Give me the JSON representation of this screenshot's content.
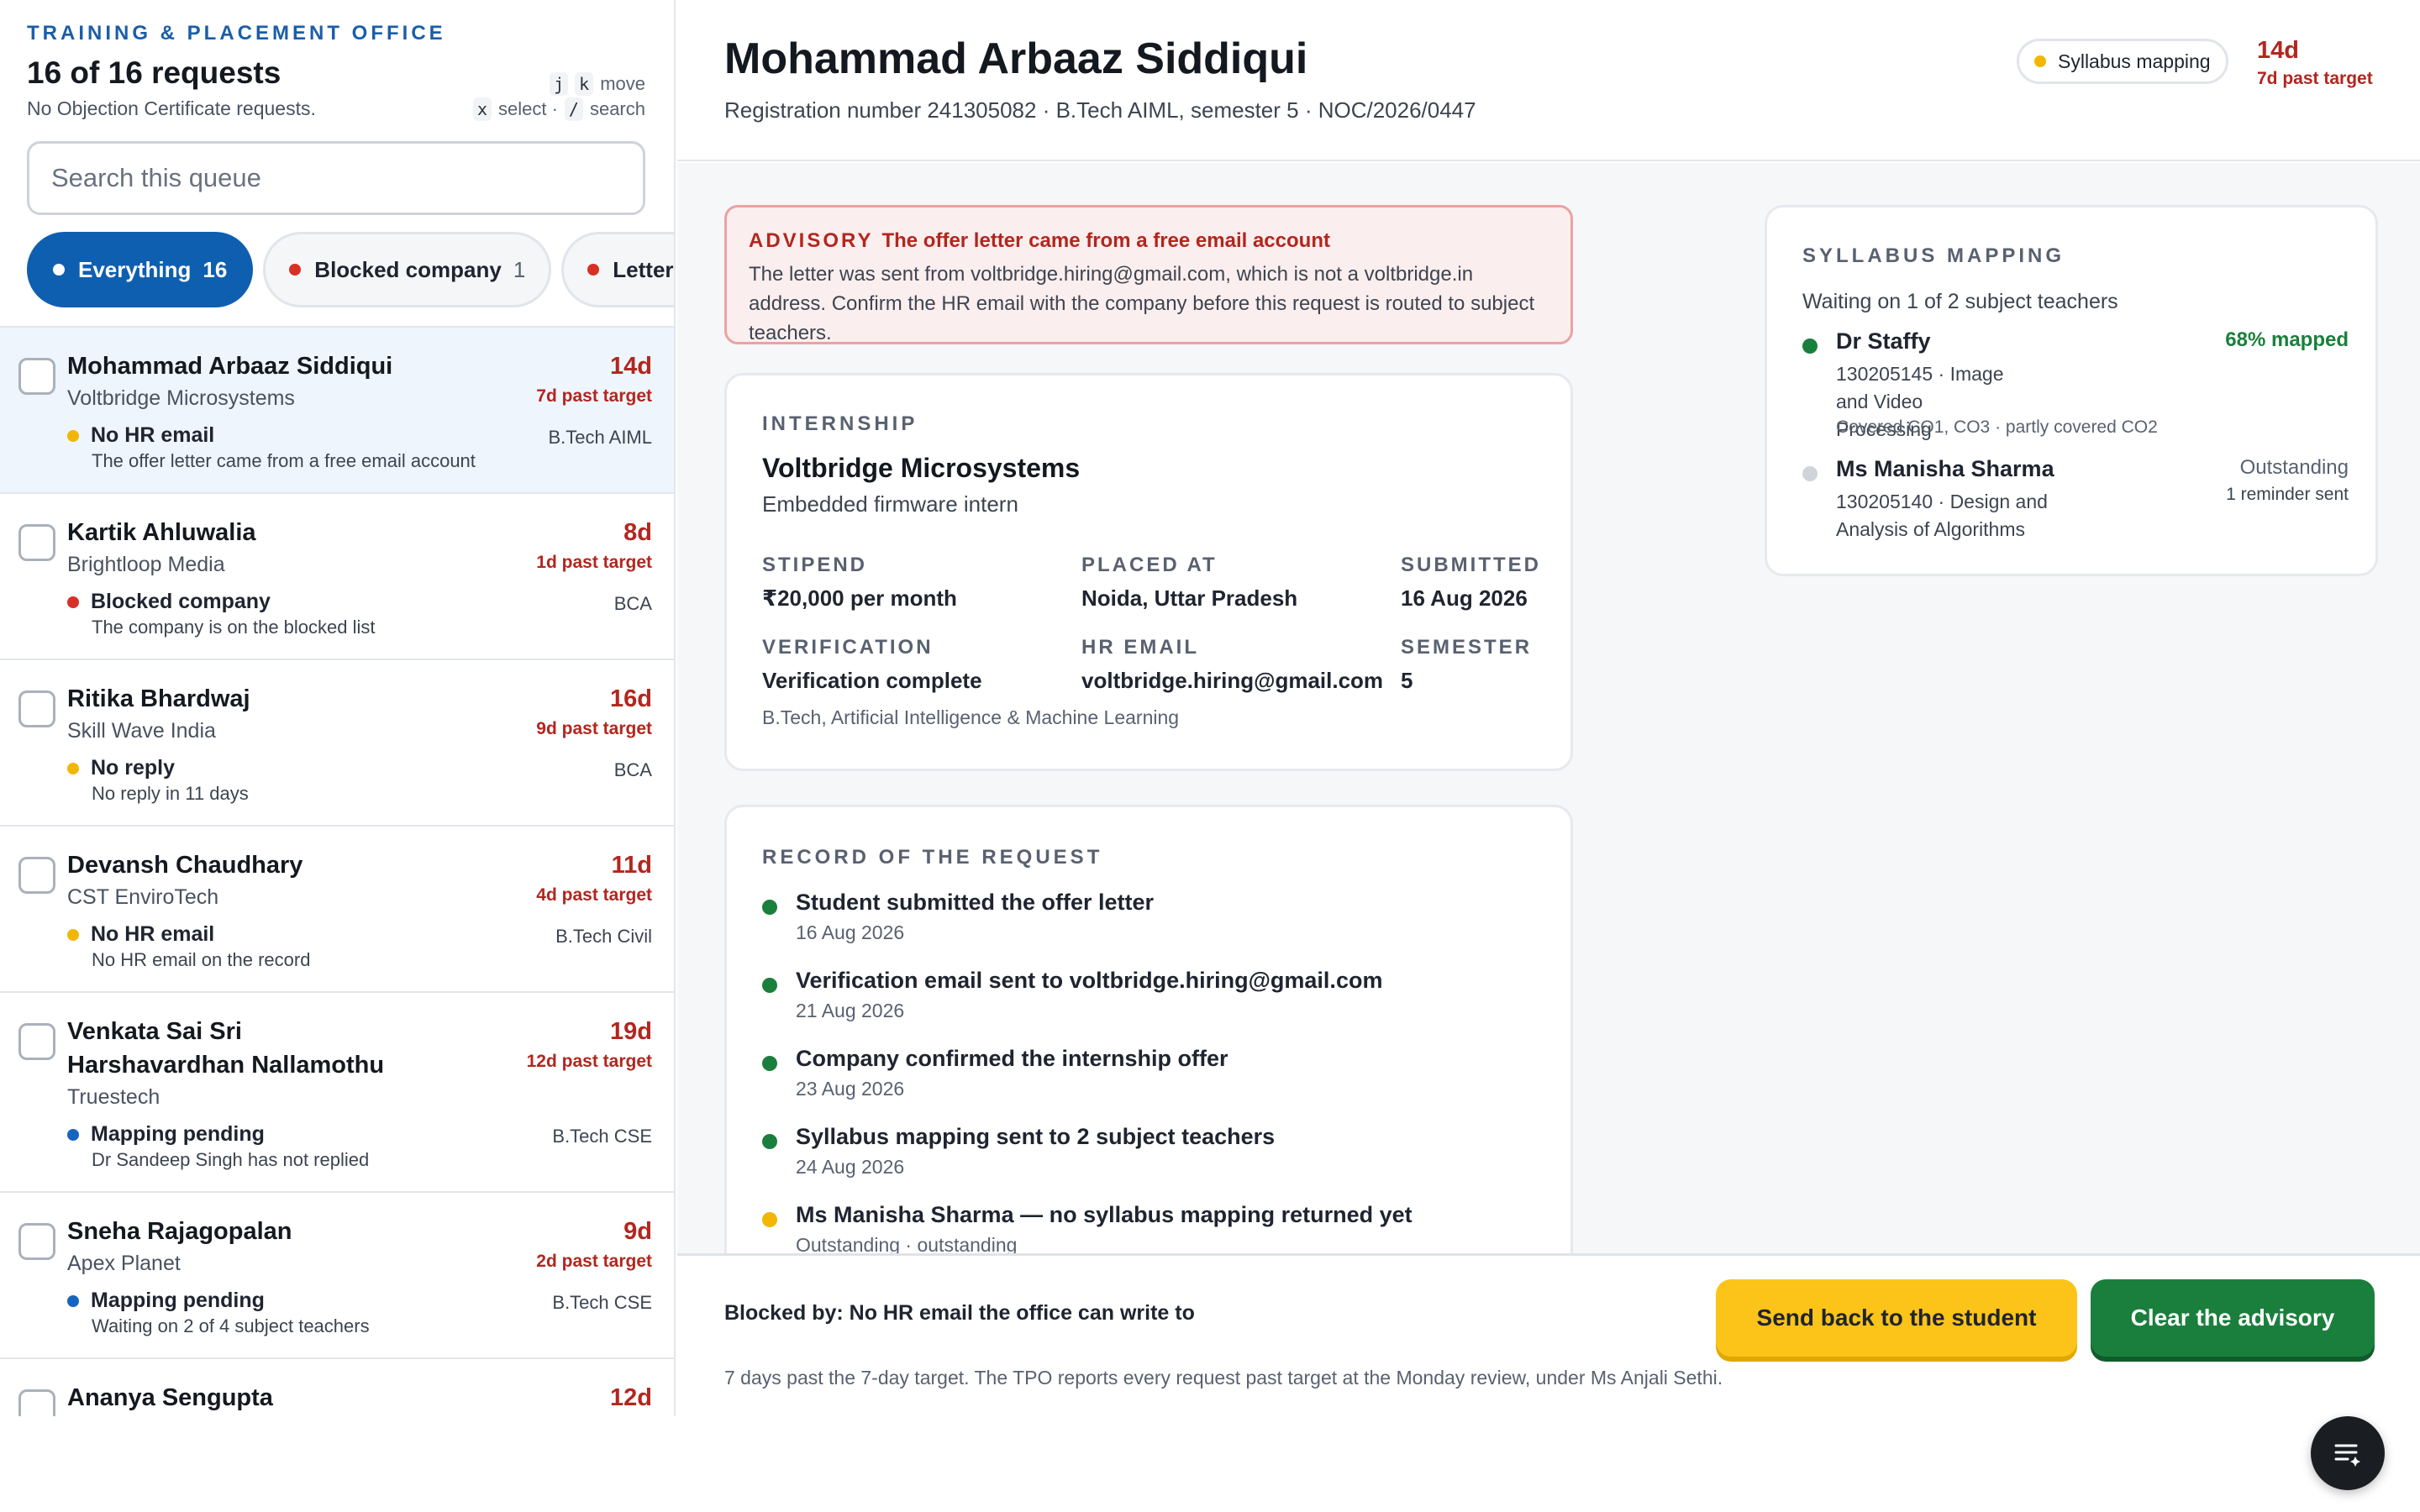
{
  "queue": {
    "office": "TRAINING & PLACEMENT OFFICE",
    "count": "16 of 16 requests",
    "subtitle": "No Objection Certificate requests.",
    "shortcuts": {
      "j": "j",
      "k": "k",
      "move": "move",
      "x": "x",
      "select": "select ·",
      "slash": "/",
      "search": "search"
    },
    "search_placeholder": "Search this queue",
    "filters": [
      {
        "label": "Everything",
        "count": "16",
        "dot_color": "#ffffff"
      },
      {
        "label": "Blocked company",
        "count": "1",
        "dot_color": "#d93025"
      },
      {
        "label": "Letter unre",
        "count": "",
        "dot_color": "#d93025"
      }
    ],
    "items": [
      {
        "name": "Mohammad Arbaaz Siddiqui",
        "company": "Voltbridge Microsystems",
        "age": "14d",
        "past": "7d past target",
        "status": "No HR email",
        "status_color": "#f2b705",
        "detail": "The offer letter came from a free email account",
        "program": "B.Tech AIML"
      },
      {
        "name": "Kartik Ahluwalia",
        "company": "Brightloop Media",
        "age": "8d",
        "past": "1d past target",
        "status": "Blocked company",
        "status_color": "#d93025",
        "detail": "The company is on the blocked list",
        "program": "BCA"
      },
      {
        "name": "Ritika Bhardwaj",
        "company": "Skill Wave India",
        "age": "16d",
        "past": "9d past target",
        "status": "No reply",
        "status_color": "#f2b705",
        "detail": "No reply in 11 days",
        "program": "BCA"
      },
      {
        "name": "Devansh Chaudhary",
        "company": "CST EnviroTech",
        "age": "11d",
        "past": "4d past target",
        "status": "No HR email",
        "status_color": "#f2b705",
        "detail": "No HR email on the record",
        "program": "B.Tech Civil"
      },
      {
        "name": "Venkata Sai Sri Harshavardhan Nallamothu",
        "company": "Truestech",
        "age": "19d",
        "past": "12d past target",
        "status": "Mapping pending",
        "status_color": "#1565c0",
        "detail": "Dr Sandeep Singh has not replied",
        "program": "B.Tech CSE"
      },
      {
        "name": "Sneha Rajagopalan",
        "company": "Apex Planet",
        "age": "9d",
        "past": "2d past target",
        "status": "Mapping pending",
        "status_color": "#1565c0",
        "detail": "Waiting on 2 of 4 subject teachers",
        "program": "B.Tech CSE"
      },
      {
        "name": "Ananya Sengupta",
        "company": "",
        "age": "12d",
        "past": "",
        "status": "",
        "status_color": "#f2b705",
        "detail": "",
        "program": ""
      }
    ]
  },
  "header": {
    "name": "Mohammad Arbaaz Siddiqui",
    "meta": "Registration number 241305082 · B.Tech AIML, semester 5 · NOC/2026/0447",
    "stage": "Syllabus mapping",
    "age": "14d",
    "past": "7d past target"
  },
  "advisory": {
    "tag": "ADVISORY",
    "title": "The offer letter came from a free email account",
    "body": "The letter was sent from voltbridge.hiring@gmail.com, which is not a voltbridge.in address. Confirm the HR email with the company before this request is routed to subject teachers."
  },
  "internship": {
    "section": "INTERNSHIP",
    "company": "Voltbridge Microsystems",
    "role": "Embedded firmware intern",
    "fields": {
      "stipend_label": "STIPEND",
      "stipend": "₹20,000 per month",
      "placed_label": "PLACED AT",
      "placed": "Noida, Uttar Pradesh",
      "submitted_label": "SUBMITTED",
      "submitted": "16 Aug 2026",
      "verification_label": "VERIFICATION",
      "verification": "Verification complete",
      "hr_label": "HR EMAIL",
      "hr": "voltbridge.hiring@gmail.com",
      "semester_label": "SEMESTER",
      "semester": "5"
    },
    "program": "B.Tech, Artificial Intelligence & Machine Learning"
  },
  "record": {
    "section": "RECORD OF THE REQUEST",
    "events": [
      {
        "title": "Student submitted the offer letter",
        "date": "16 Aug 2026",
        "color": "#1a7f3c"
      },
      {
        "title": "Verification email sent to voltbridge.hiring@gmail.com",
        "date": "21 Aug 2026",
        "color": "#1a7f3c"
      },
      {
        "title": "Company confirmed the internship offer",
        "date": "23 Aug 2026",
        "color": "#1a7f3c"
      },
      {
        "title": "Syllabus mapping sent to 2 subject teachers",
        "date": "24 Aug 2026",
        "color": "#1a7f3c"
      },
      {
        "title": "Ms Manisha Sharma — no syllabus mapping returned yet",
        "date": "Outstanding · outstanding",
        "color": "#f2b705"
      }
    ]
  },
  "syllabus": {
    "section": "SYLLABUS MAPPING",
    "subtitle": "Waiting on 1 of 2 subject teachers",
    "teachers": [
      {
        "name": "Dr Staffy",
        "subject": "130205145 · Image and Video Processing",
        "coverage": "Covered CO1, CO3 · partly covered CO2",
        "result": "68% mapped",
        "result_color": "#1a7f3c",
        "note": "",
        "dot": "#1a7f3c"
      },
      {
        "name": "Ms Manisha Sharma",
        "subject": "130205140 · Design and Analysis of Algorithms",
        "coverage": "",
        "result": "Outstanding",
        "result_color": "#596170",
        "note": "1 reminder sent",
        "dot": "#cfd3da"
      }
    ]
  },
  "footer": {
    "blocked_prefix": "Blocked by:",
    "blocked_reason": "No HR email the office can write to",
    "send_back": "Send back to the student",
    "clear": "Clear the advisory",
    "note": "7 days past the 7-day target. The TPO reports every request past target at the Monday review, under Ms Anjali Sethi."
  },
  "icons": {
    "fab": "filter-list-icon"
  }
}
